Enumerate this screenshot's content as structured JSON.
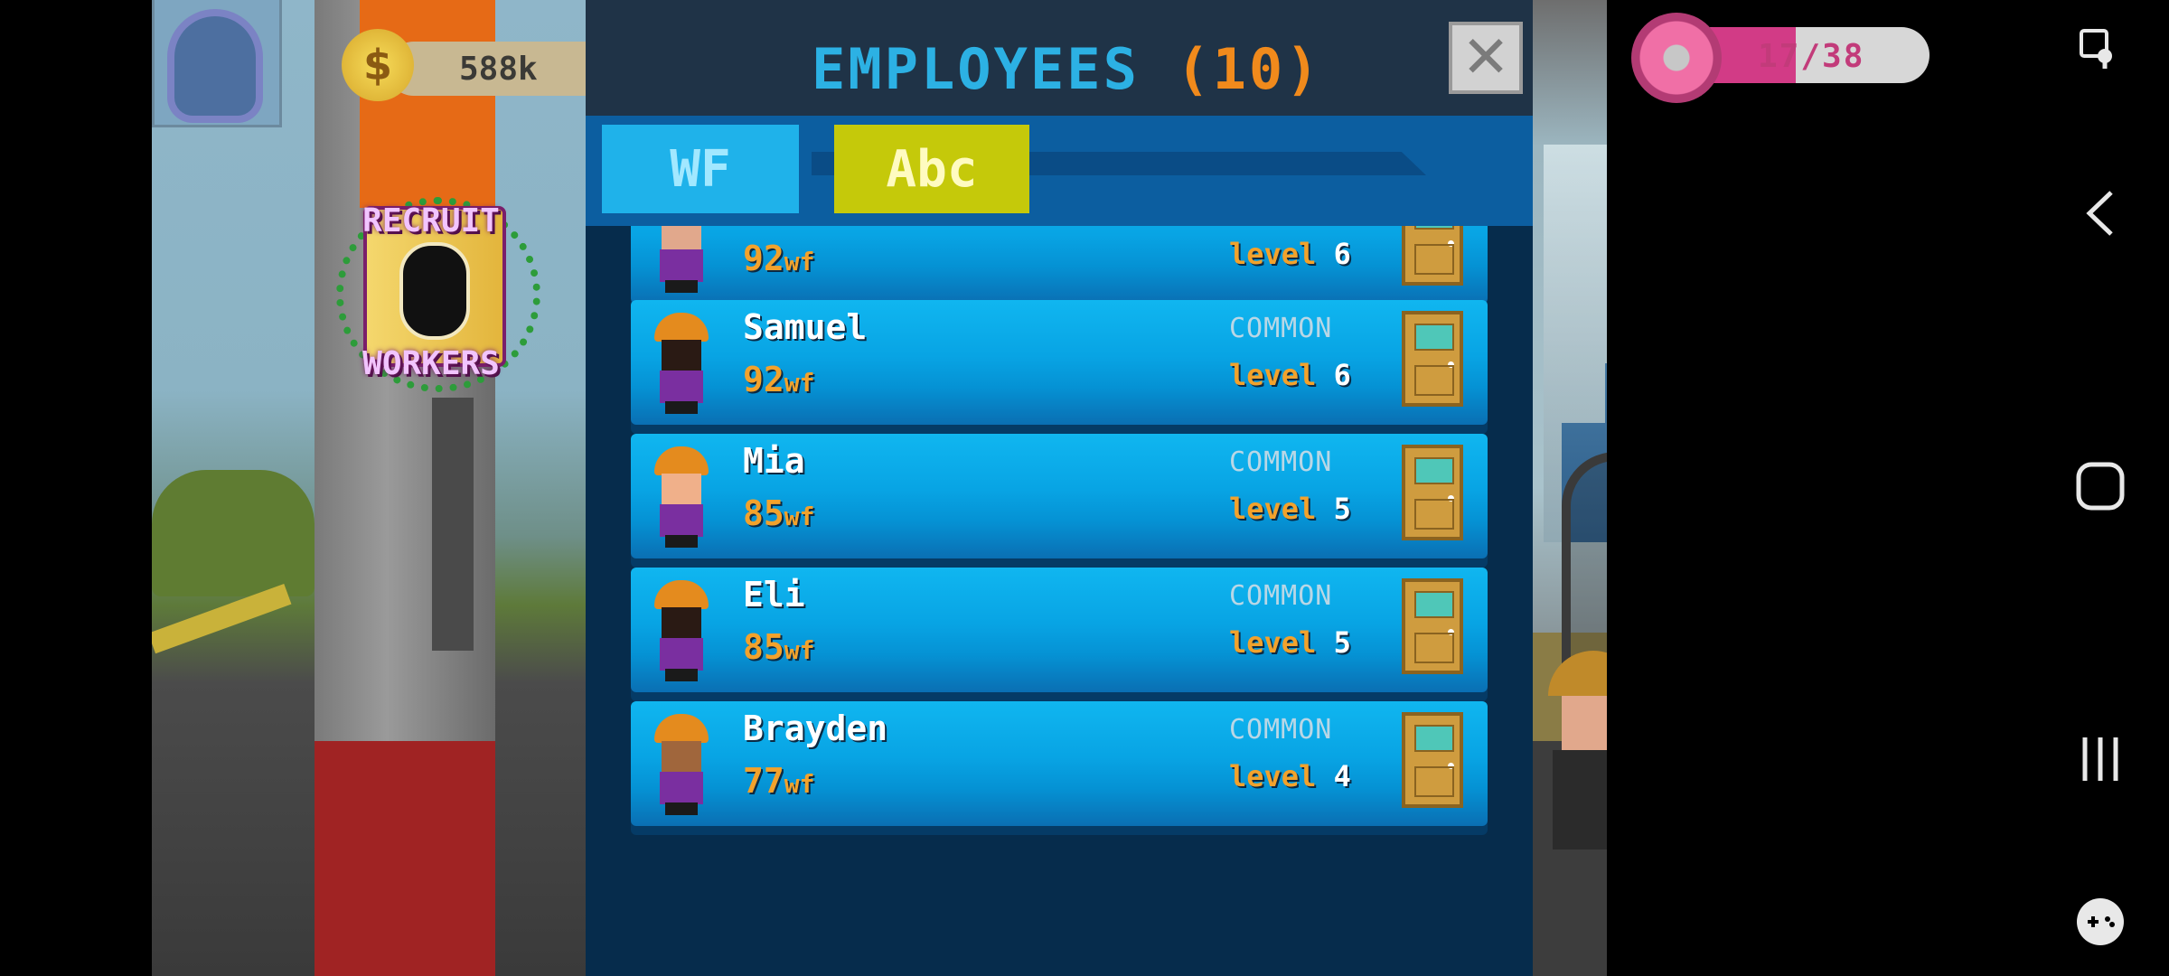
{
  "hud": {
    "money": "588k",
    "coin_symbol": "$",
    "donut_text": "17/38",
    "donut_progress": 0.45
  },
  "recruit": {
    "line1": "RECRUIT",
    "line2": "WORKERS"
  },
  "modal": {
    "title_main": "EMPLOYEES",
    "title_count": "(10)",
    "close_symbol": "✕",
    "tabs": [
      {
        "label": "WF"
      },
      {
        "label": "Abc"
      }
    ],
    "rows": [
      {
        "name": "",
        "wf": "92",
        "wf_unit": "wf",
        "rarity": "",
        "level_label": "level",
        "level": "6",
        "face": "#e1a88c"
      },
      {
        "name": "Samuel",
        "wf": "92",
        "wf_unit": "wf",
        "rarity": "COMMON",
        "level_label": "level",
        "level": "6",
        "face": "#2a1a14"
      },
      {
        "name": "Mia",
        "wf": "85",
        "wf_unit": "wf",
        "rarity": "COMMON",
        "level_label": "level",
        "level": "5",
        "face": "#f0b08a"
      },
      {
        "name": "Eli",
        "wf": "85",
        "wf_unit": "wf",
        "rarity": "COMMON",
        "level_label": "level",
        "level": "5",
        "face": "#2a1a14"
      },
      {
        "name": "Brayden",
        "wf": "77",
        "wf_unit": "wf",
        "rarity": "COMMON",
        "level_label": "level",
        "level": "4",
        "face": "#a0663c"
      }
    ]
  },
  "colors": {
    "title_blue": "#2cb1e4",
    "title_orange": "#f08a1c",
    "tab_wf": "#1fb2ea",
    "tab_abc": "#c5c90a",
    "row_blue": "#08a4e4",
    "donut_pink": "#d23b86"
  },
  "navbar": {
    "icons": [
      "screenshot-icon",
      "back-icon",
      "home-icon",
      "recents-icon",
      "game-tools-icon"
    ]
  }
}
